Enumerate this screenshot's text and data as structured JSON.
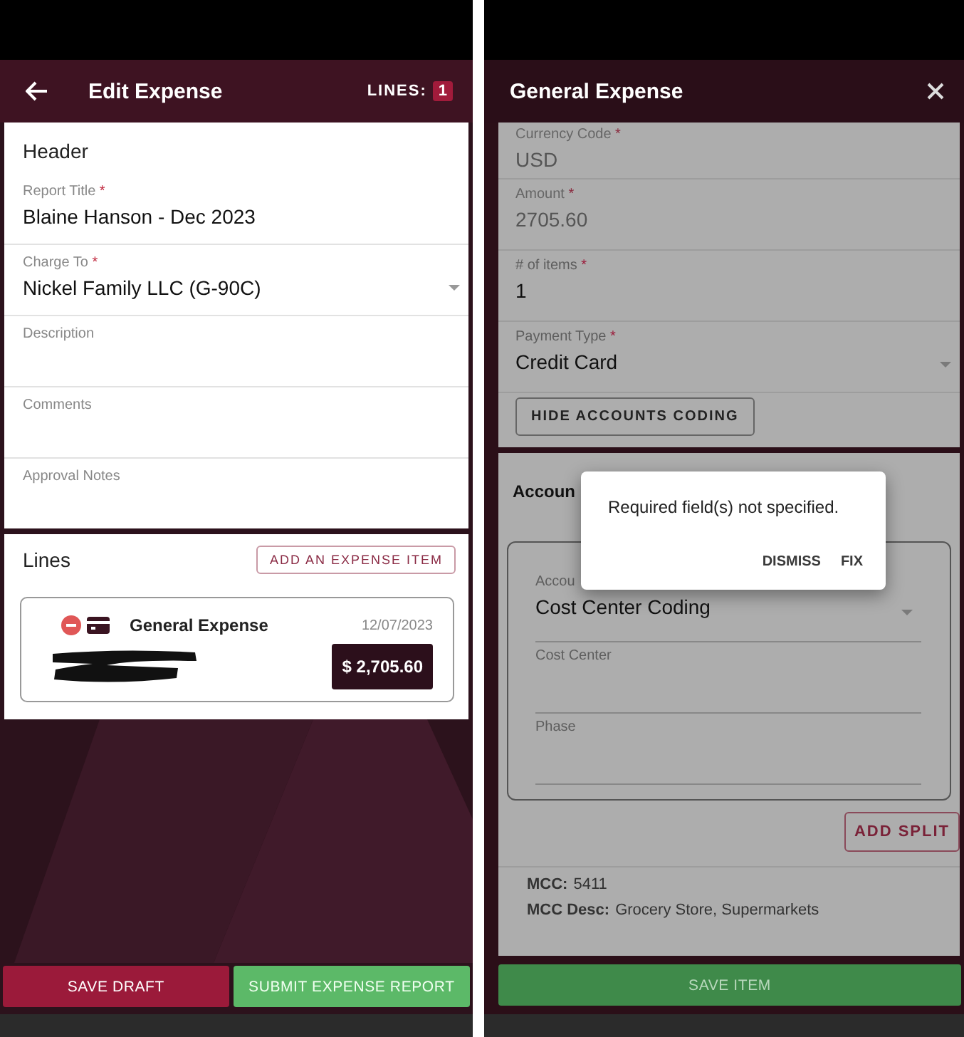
{
  "edit_screen": {
    "title": "Edit Expense",
    "lines_label": "LINES:",
    "lines_count": "1",
    "header_section": {
      "title": "Header",
      "fields": [
        {
          "label": "Report Title",
          "required_mark": "*",
          "value": "Blaine Hanson - Dec 2023",
          "kind": "text"
        },
        {
          "label": "Charge To",
          "required_mark": "*",
          "value": "Nickel Family LLC (G-90C)",
          "kind": "dropdown"
        },
        {
          "label": "Description",
          "kind": "text"
        },
        {
          "label": "Comments",
          "kind": "text"
        },
        {
          "label": "Approval Notes",
          "kind": "text"
        }
      ]
    },
    "lines_section": {
      "title": "Lines",
      "add_button": "ADD AN EXPENSE ITEM",
      "items": [
        {
          "type": "General Expense",
          "date": "12/07/2023",
          "amount": "$ 2,705.60",
          "redacted": true
        }
      ]
    },
    "buttons": [
      {
        "label": "SAVE DRAFT",
        "kind": "secondary"
      },
      {
        "label": "SUBMIT EXPENSE REPORT",
        "kind": "primary"
      }
    ]
  },
  "item_screen": {
    "title": "General Expense",
    "fields": [
      {
        "label": "Currency Code",
        "required_mark": "*",
        "value": "USD",
        "kind": "text",
        "disabled": true
      },
      {
        "label": "Amount",
        "required_mark": "*",
        "value": "2705.60",
        "kind": "text",
        "disabled": true
      },
      {
        "label": "# of items",
        "required_mark": "*",
        "value": "1",
        "kind": "text",
        "disabled": false
      },
      {
        "label": "Payment Type",
        "required_mark": "*",
        "value": "Credit Card",
        "kind": "dropdown",
        "disabled": false
      }
    ],
    "toggle_button": "HIDE ACCOUNTS CODING",
    "accounts": {
      "title": "Accoun",
      "split_fields": [
        {
          "label": "Accou",
          "value": "Cost Center Coding",
          "kind": "dropdown"
        },
        {
          "label": "Cost Center",
          "kind": "text"
        },
        {
          "label": "Phase",
          "kind": "text"
        }
      ],
      "add_split": "ADD SPLIT"
    },
    "mcc": [
      {
        "label": "MCC:",
        "value": "5411"
      },
      {
        "label": "MCC Desc:",
        "value": "Grocery Store, Supermarkets"
      }
    ],
    "save_button": "SAVE ITEM",
    "dialog": {
      "message": "Required field(s) not specified.",
      "actions": [
        "DISMISS",
        "FIX"
      ]
    }
  }
}
